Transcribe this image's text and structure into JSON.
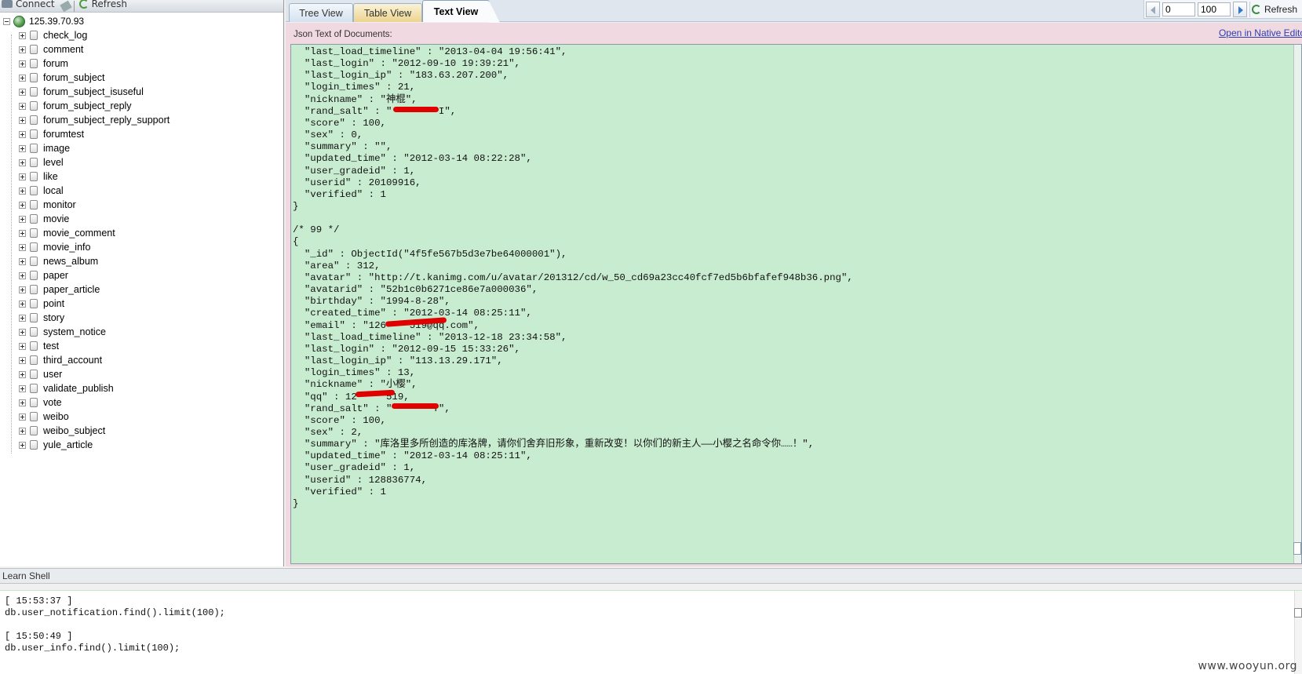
{
  "toolbar": {
    "connect_label": "Connect",
    "refresh_label": "Refresh"
  },
  "tree": {
    "server": "125.39.70.93",
    "collections": [
      "check_log",
      "comment",
      "forum",
      "forum_subject",
      "forum_subject_isuseful",
      "forum_subject_reply",
      "forum_subject_reply_support",
      "forumtest",
      "image",
      "level",
      "like",
      "local",
      "monitor",
      "movie",
      "movie_comment",
      "movie_info",
      "news_album",
      "paper",
      "paper_article",
      "point",
      "story",
      "system_notice",
      "test",
      "third_account",
      "user",
      "validate_publish",
      "vote",
      "weibo",
      "weibo_subject",
      "yule_article"
    ]
  },
  "tabs": {
    "tree_view": "Tree View",
    "table_view": "Table View",
    "text_view": "Text View"
  },
  "pager": {
    "skip": "0",
    "limit": "100",
    "refresh_label": "Refresh"
  },
  "json_panel": {
    "label": "Json Text of Documents:",
    "open_native": "Open in Native Editor",
    "lines": [
      "  \"last_load_timeline\" : \"2013-04-04 19:56:41\",",
      "  \"last_login\" : \"2012-09-10 19:39:21\",",
      "  \"last_login_ip\" : \"183.63.207.200\",",
      "  \"login_times\" : 21,",
      "  \"nickname\" : \"神棍\",",
      "  \"rand_salt\" : \"        I\",",
      "  \"score\" : 100,",
      "  \"sex\" : 0,",
      "  \"summary\" : \"\",",
      "  \"updated_time\" : \"2012-03-14 08:22:28\",",
      "  \"user_gradeid\" : 1,",
      "  \"userid\" : 20109916,",
      "  \"verified\" : 1",
      "}",
      "",
      "/* 99 */",
      "{",
      "  \"_id\" : ObjectId(\"4f5fe567b5d3e7be64000001\"),",
      "  \"area\" : 312,",
      "  \"avatar\" : \"http://t.kanimg.com/u/avatar/201312/cd/w_50_cd69a23cc40fcf7ed5b6bfafef948b36.png\",",
      "  \"avatarid\" : \"52b1c0b6271ce86e7a000036\",",
      "  \"birthday\" : \"1994-8-28\",",
      "  \"created_time\" : \"2012-03-14 08:25:11\",",
      "  \"email\" : \"126    519@qq.com\",",
      "  \"last_load_timeline\" : \"2013-12-18 23:34:58\",",
      "  \"last_login\" : \"2012-09-15 15:33:26\",",
      "  \"last_login_ip\" : \"113.13.29.171\",",
      "  \"login_times\" : 13,",
      "  \"nickname\" : \"小樱\",",
      "  \"qq\" : 12     519,",
      "  \"rand_salt\" : \"       Y\",",
      "  \"score\" : 100,",
      "  \"sex\" : 2,",
      "  \"summary\" : \"库洛里多所创造的库洛牌，请你们舍弃旧形象，重新改变！以你们的新主人——小樱之名命令你……！\",",
      "  \"updated_time\" : \"2012-03-14 08:25:11\",",
      "  \"user_gradeid\" : 1,",
      "  \"userid\" : 128836774,",
      "  \"verified\" : 1",
      "}"
    ]
  },
  "shell": {
    "title": "Learn Shell",
    "lines": [
      "[ 15:53:37 ]",
      "db.user_notification.find().limit(100);",
      "",
      "[ 15:50:49 ]",
      "db.user_info.find().limit(100);"
    ]
  },
  "watermark": "www.wooyun.org"
}
